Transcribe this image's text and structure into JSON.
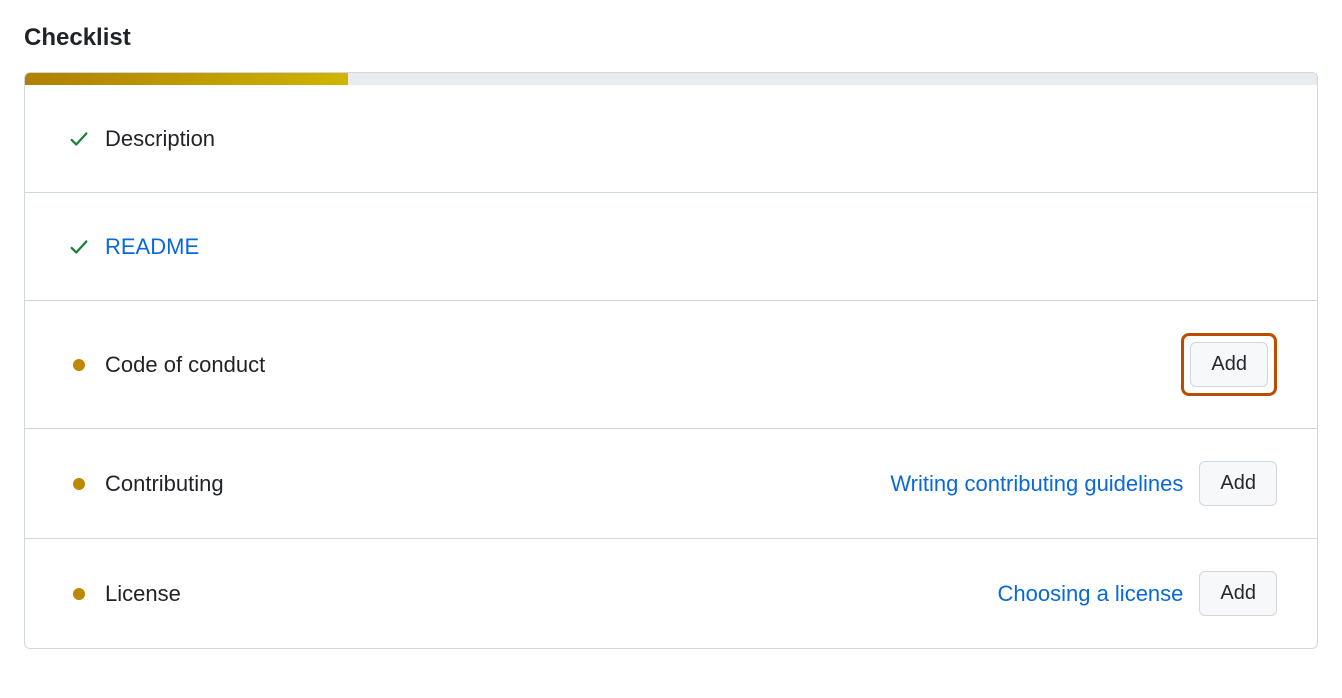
{
  "title": "Checklist",
  "progress_percent": 25,
  "buttons": {
    "add": "Add"
  },
  "items": [
    {
      "label": "Description",
      "status": "done",
      "is_link": false
    },
    {
      "label": "README",
      "status": "done",
      "is_link": true
    },
    {
      "label": "Code of conduct",
      "status": "pending",
      "is_link": false,
      "highlight_add": true
    },
    {
      "label": "Contributing",
      "status": "pending",
      "is_link": false,
      "help_text": "Writing contributing guidelines"
    },
    {
      "label": "License",
      "status": "pending",
      "is_link": false,
      "help_text": "Choosing a license"
    }
  ]
}
